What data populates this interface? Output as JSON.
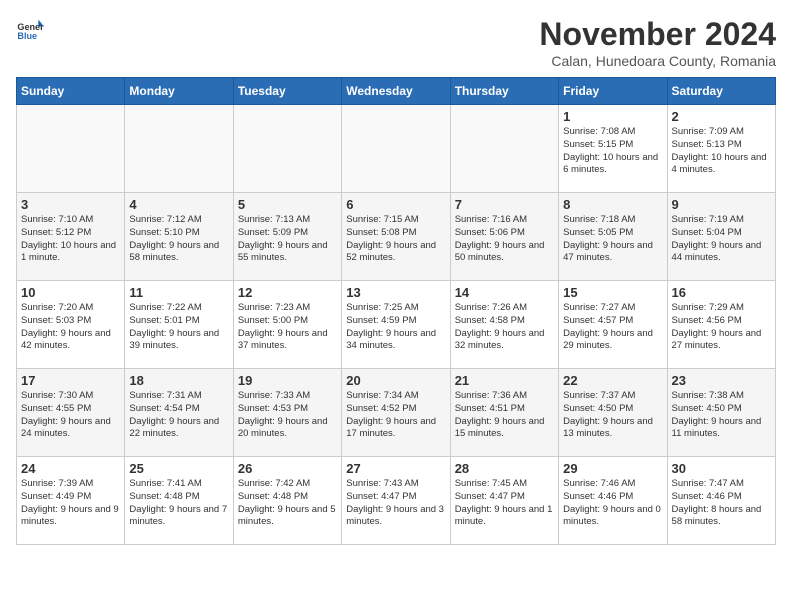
{
  "header": {
    "logo_general": "General",
    "logo_blue": "Blue",
    "month_title": "November 2024",
    "subtitle": "Calan, Hunedoara County, Romania"
  },
  "days_of_week": [
    "Sunday",
    "Monday",
    "Tuesday",
    "Wednesday",
    "Thursday",
    "Friday",
    "Saturday"
  ],
  "weeks": [
    [
      {
        "day": "",
        "info": ""
      },
      {
        "day": "",
        "info": ""
      },
      {
        "day": "",
        "info": ""
      },
      {
        "day": "",
        "info": ""
      },
      {
        "day": "",
        "info": ""
      },
      {
        "day": "1",
        "info": "Sunrise: 7:08 AM\nSunset: 5:15 PM\nDaylight: 10 hours and 6 minutes."
      },
      {
        "day": "2",
        "info": "Sunrise: 7:09 AM\nSunset: 5:13 PM\nDaylight: 10 hours and 4 minutes."
      }
    ],
    [
      {
        "day": "3",
        "info": "Sunrise: 7:10 AM\nSunset: 5:12 PM\nDaylight: 10 hours and 1 minute."
      },
      {
        "day": "4",
        "info": "Sunrise: 7:12 AM\nSunset: 5:10 PM\nDaylight: 9 hours and 58 minutes."
      },
      {
        "day": "5",
        "info": "Sunrise: 7:13 AM\nSunset: 5:09 PM\nDaylight: 9 hours and 55 minutes."
      },
      {
        "day": "6",
        "info": "Sunrise: 7:15 AM\nSunset: 5:08 PM\nDaylight: 9 hours and 52 minutes."
      },
      {
        "day": "7",
        "info": "Sunrise: 7:16 AM\nSunset: 5:06 PM\nDaylight: 9 hours and 50 minutes."
      },
      {
        "day": "8",
        "info": "Sunrise: 7:18 AM\nSunset: 5:05 PM\nDaylight: 9 hours and 47 minutes."
      },
      {
        "day": "9",
        "info": "Sunrise: 7:19 AM\nSunset: 5:04 PM\nDaylight: 9 hours and 44 minutes."
      }
    ],
    [
      {
        "day": "10",
        "info": "Sunrise: 7:20 AM\nSunset: 5:03 PM\nDaylight: 9 hours and 42 minutes."
      },
      {
        "day": "11",
        "info": "Sunrise: 7:22 AM\nSunset: 5:01 PM\nDaylight: 9 hours and 39 minutes."
      },
      {
        "day": "12",
        "info": "Sunrise: 7:23 AM\nSunset: 5:00 PM\nDaylight: 9 hours and 37 minutes."
      },
      {
        "day": "13",
        "info": "Sunrise: 7:25 AM\nSunset: 4:59 PM\nDaylight: 9 hours and 34 minutes."
      },
      {
        "day": "14",
        "info": "Sunrise: 7:26 AM\nSunset: 4:58 PM\nDaylight: 9 hours and 32 minutes."
      },
      {
        "day": "15",
        "info": "Sunrise: 7:27 AM\nSunset: 4:57 PM\nDaylight: 9 hours and 29 minutes."
      },
      {
        "day": "16",
        "info": "Sunrise: 7:29 AM\nSunset: 4:56 PM\nDaylight: 9 hours and 27 minutes."
      }
    ],
    [
      {
        "day": "17",
        "info": "Sunrise: 7:30 AM\nSunset: 4:55 PM\nDaylight: 9 hours and 24 minutes."
      },
      {
        "day": "18",
        "info": "Sunrise: 7:31 AM\nSunset: 4:54 PM\nDaylight: 9 hours and 22 minutes."
      },
      {
        "day": "19",
        "info": "Sunrise: 7:33 AM\nSunset: 4:53 PM\nDaylight: 9 hours and 20 minutes."
      },
      {
        "day": "20",
        "info": "Sunrise: 7:34 AM\nSunset: 4:52 PM\nDaylight: 9 hours and 17 minutes."
      },
      {
        "day": "21",
        "info": "Sunrise: 7:36 AM\nSunset: 4:51 PM\nDaylight: 9 hours and 15 minutes."
      },
      {
        "day": "22",
        "info": "Sunrise: 7:37 AM\nSunset: 4:50 PM\nDaylight: 9 hours and 13 minutes."
      },
      {
        "day": "23",
        "info": "Sunrise: 7:38 AM\nSunset: 4:50 PM\nDaylight: 9 hours and 11 minutes."
      }
    ],
    [
      {
        "day": "24",
        "info": "Sunrise: 7:39 AM\nSunset: 4:49 PM\nDaylight: 9 hours and 9 minutes."
      },
      {
        "day": "25",
        "info": "Sunrise: 7:41 AM\nSunset: 4:48 PM\nDaylight: 9 hours and 7 minutes."
      },
      {
        "day": "26",
        "info": "Sunrise: 7:42 AM\nSunset: 4:48 PM\nDaylight: 9 hours and 5 minutes."
      },
      {
        "day": "27",
        "info": "Sunrise: 7:43 AM\nSunset: 4:47 PM\nDaylight: 9 hours and 3 minutes."
      },
      {
        "day": "28",
        "info": "Sunrise: 7:45 AM\nSunset: 4:47 PM\nDaylight: 9 hours and 1 minute."
      },
      {
        "day": "29",
        "info": "Sunrise: 7:46 AM\nSunset: 4:46 PM\nDaylight: 9 hours and 0 minutes."
      },
      {
        "day": "30",
        "info": "Sunrise: 7:47 AM\nSunset: 4:46 PM\nDaylight: 8 hours and 58 minutes."
      }
    ]
  ]
}
